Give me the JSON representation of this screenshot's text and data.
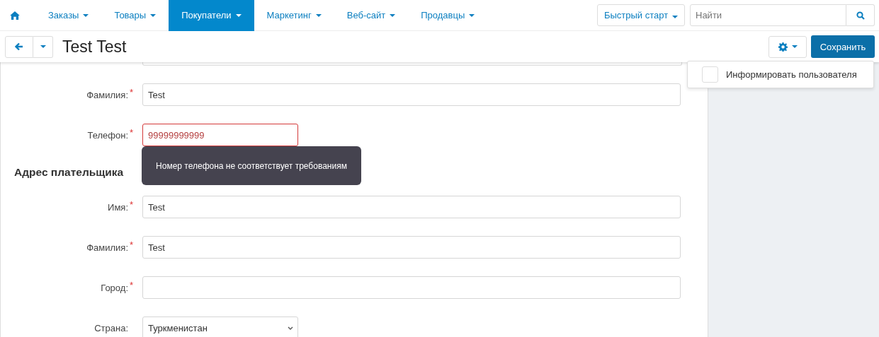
{
  "nav": {
    "items": [
      {
        "label": "Заказы",
        "selected": false
      },
      {
        "label": "Товары",
        "selected": false
      },
      {
        "label": "Покупатели",
        "selected": true
      },
      {
        "label": "Маркетинг",
        "selected": false
      },
      {
        "label": "Веб-сайт",
        "selected": false
      },
      {
        "label": "Продавцы",
        "selected": false
      }
    ],
    "quick_start": "Быстрый старт",
    "search": {
      "placeholder": "Найти"
    }
  },
  "toolbar": {
    "title": "Test Test",
    "save": "Сохранить"
  },
  "menu": {
    "items": [
      {
        "label": "Информировать пользователя",
        "checked": false
      }
    ]
  },
  "form": {
    "rows": [
      {
        "kind": "field",
        "label": "Фамилия:",
        "required_mark": "*",
        "value": "Test",
        "narrow": false
      },
      {
        "kind": "field",
        "label": "Телефон:",
        "required_mark": "*",
        "value": "99999999999",
        "narrow": true,
        "error": "Номер телефона не соответствует требованиям"
      },
      {
        "kind": "heading",
        "label": "Адрес плательщика"
      },
      {
        "kind": "field",
        "label": "Имя:",
        "required_mark": "*",
        "value": "Test",
        "narrow": false
      },
      {
        "kind": "field",
        "label": "Фамилия:",
        "required_mark": "*",
        "value": "Test",
        "narrow": false
      },
      {
        "kind": "field",
        "label": "Город:",
        "required_mark": "*",
        "value": "",
        "narrow": false
      },
      {
        "kind": "select",
        "label": "Страна:",
        "value": "Туркменистан",
        "narrow": true
      }
    ]
  }
}
